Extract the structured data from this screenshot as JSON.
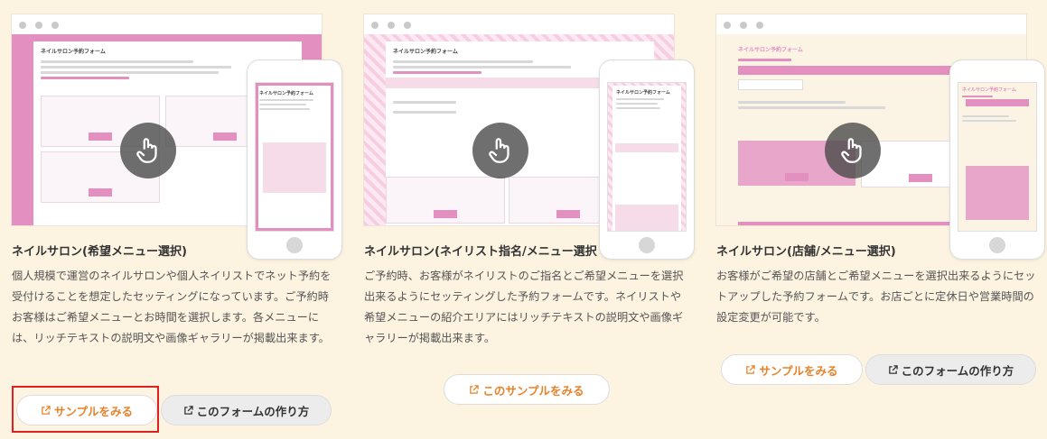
{
  "cards": [
    {
      "title": "ネイルサロン(希望メニュー選択)",
      "description": "個人規模で運営のネイルサロンや個人ネイリストでネット予約を受付けることを想定したセッティングになっています。ご予約時お客様はご希望メニューとお時間を選択します。各メニューには、リッチテキストの説明文や画像ギャラリーが掲載出来ます。",
      "sample_label": "サンプルをみる",
      "howto_label": "このフォームの作り方",
      "preview_form_title": "ネイルサロン予約フォーム"
    },
    {
      "title": "ネイルサロン(ネイリスト指名/メニュー選択",
      "description": "ご予約時、お客様がネイリストのご指名とご希望メニューを選択出来るようにセッティングした予約フォームです。ネイリストや希望メニューの紹介エリアにはリッチテキストの説明文や画像ギャラリーが掲載出来ます。",
      "sample_label": "このサンプルをみる",
      "preview_form_title": "ネイルサロン予約フォーム"
    },
    {
      "title": "ネイルサロン(店舗/メニュー選択)",
      "description": "お客様がご希望の店舗とご希望メニューを選択出来るようにセットアップした予約フォームです。お店ごとに定休日や営業時間の設定変更が可能です。",
      "sample_label": "サンプルをみる",
      "howto_label": "このフォームの作り方",
      "preview_form_title": "ネイルサロン予約フォーム"
    }
  ],
  "colors": {
    "background": "#fdf3e1",
    "accent": "#e8822a",
    "pink": "#e38fc0",
    "highlight": "#e02020"
  },
  "icons": {
    "pointer": "hand-pointer-icon",
    "external": "external-link-icon"
  }
}
